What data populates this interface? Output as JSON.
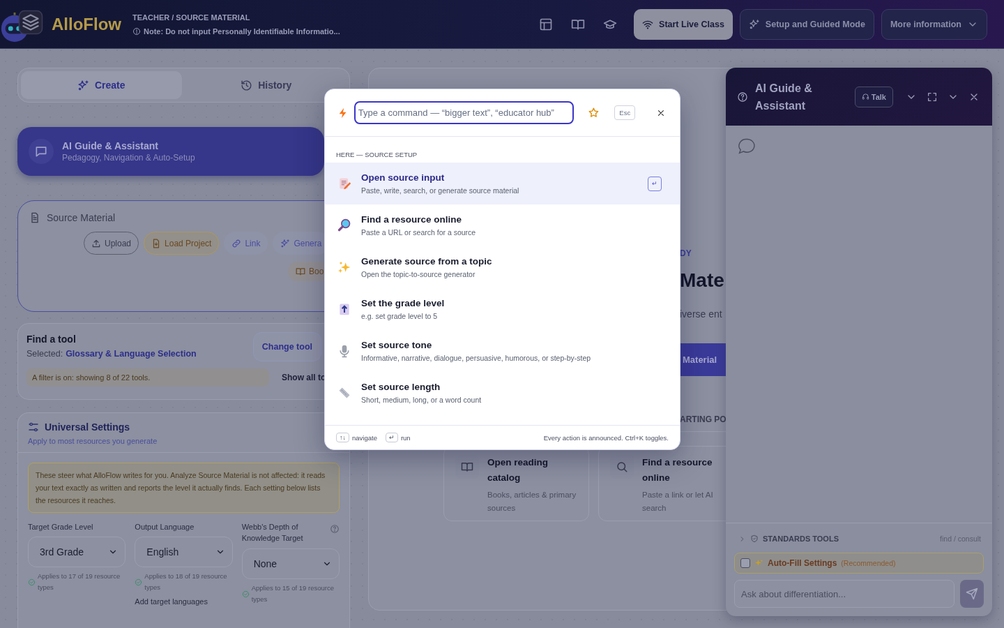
{
  "header": {
    "app_name": "AlloFlow",
    "breadcrumb": "TEACHER / SOURCE MATERIAL",
    "note": "Note: Do not input Personally Identifiable Informatio...",
    "buttons": [
      {
        "label": "Start Live Class",
        "kind": "live"
      },
      {
        "label": "Setup and Guided Mode",
        "kind": "guided"
      },
      {
        "label": "More information",
        "kind": "menu"
      }
    ]
  },
  "tabs": [
    {
      "label": "Create",
      "selected": true
    },
    {
      "label": "History",
      "selected": false
    }
  ],
  "guide_card": {
    "title": "AI Guide & Assistant",
    "subtitle": "Pedagogy, Navigation & Auto-Setup"
  },
  "source_material": {
    "title": "Source Material",
    "buttons": [
      {
        "label": "Upload",
        "kind": "upload"
      },
      {
        "label": "Load Project",
        "kind": "project"
      },
      {
        "label": "Link",
        "kind": "link"
      },
      {
        "label": "Genera",
        "kind": "generate"
      },
      {
        "label": "Boo",
        "kind": "book"
      }
    ]
  },
  "find_tool": {
    "title": "Find a tool",
    "selected_label": "Selected:",
    "selected_value": "Glossary & Language Selection",
    "change_button": "Change tool",
    "filter_note": "A filter is on: showing 8 of 22 tools.",
    "show_all": "Show all to"
  },
  "universal_settings": {
    "title": "Universal Settings",
    "subtitle": "Apply to most resources you generate",
    "note": "These steer what AlloFlow writes for you. Analyze Source Material is not affected: it reads your text exactly as written and reports the level it actually finds. Each setting below lists the resources it reaches.",
    "fields": [
      {
        "label": "Target Grade Level",
        "value": "3rd Grade",
        "applies": "Applies to 17 of 19 resource types",
        "help": false
      },
      {
        "label": "Output Language",
        "value": "English",
        "applies": "Applies to 18 of 19 resource types",
        "help": false
      },
      {
        "label": "Webb's Depth of Knowledge Target",
        "value": "None",
        "applies": "Applies to 15 of 19 resource types",
        "help": true
      }
    ],
    "add_languages": "Add target languages"
  },
  "center": {
    "hero_label": "DY",
    "hero_title": "Mate",
    "hero_text": "iverse ent",
    "hero_button": "Material",
    "section_label": "ARTING PO",
    "cards": [
      {
        "title": "Open reading catalog",
        "text": "Books, articles & primary sources",
        "kind": "book"
      },
      {
        "title": "Find a resource online",
        "text": "Paste a link or let AI search",
        "kind": "search"
      }
    ]
  },
  "assistant": {
    "title": "AI Guide & Assistant",
    "talk_button": "Talk",
    "standards": {
      "label": "STANDARDS TOOLS",
      "hint": "find / consult",
      "expanded": false
    },
    "autofill": {
      "label": "Auto-Fill Settings",
      "tag": "(Recommended)",
      "checked": false
    },
    "chat_input": {
      "placeholder": "Ask about differentiation..."
    }
  },
  "palette": {
    "command_input": {
      "placeholder": "Type a command — “bigger text”, “educator hub”"
    },
    "esc_key": "Esc",
    "section": "HERE — SOURCE SETUP",
    "enter_key": "↵",
    "commands": [
      {
        "title": "Open source input",
        "description": "Paste, write, search, or generate source material",
        "kind": "edit",
        "selected": true
      },
      {
        "title": "Find a resource online",
        "description": "Paste a URL or search for a source",
        "kind": "search",
        "selected": false
      },
      {
        "title": "Generate source from a topic",
        "description": "Open the topic-to-source generator",
        "kind": "sparkle",
        "selected": false
      },
      {
        "title": "Set the grade level",
        "description": "e.g. set grade level to 5",
        "kind": "grade",
        "selected": false
      },
      {
        "title": "Set source tone",
        "description": "Informative, narrative, dialogue, persuasive, humorous, or step-by-step",
        "kind": "mic",
        "selected": false
      },
      {
        "title": "Set source length",
        "description": "Short, medium, long, or a word count",
        "kind": "ruler",
        "selected": false
      }
    ],
    "footer": {
      "navigate_key": "↑↓",
      "navigate": "navigate",
      "run_key": "↵",
      "run": "run",
      "note": "Every action is announced. Ctrl+K toggles."
    }
  }
}
